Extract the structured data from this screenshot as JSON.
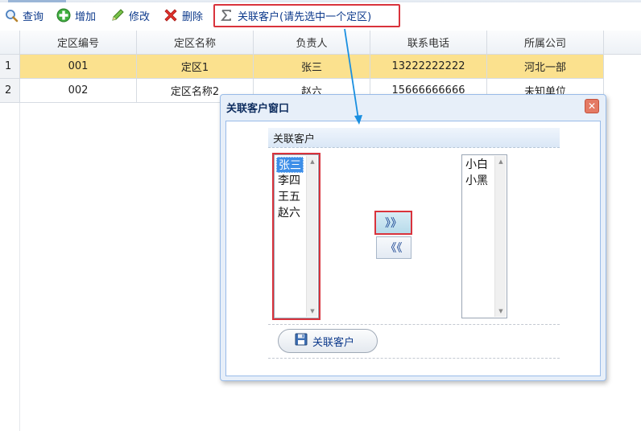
{
  "toolbar": {
    "query_label": "查询",
    "add_label": "增加",
    "edit_label": "修改",
    "delete_label": "删除",
    "assoc_label": "关联客户(请先选中一个定区)"
  },
  "grid": {
    "headers": [
      "定区编号",
      "定区名称",
      "负责人",
      "联系电话",
      "所属公司"
    ],
    "rows": [
      {
        "num": "1",
        "cells": [
          "001",
          "定区1",
          "张三",
          "13222222222",
          "河北一部"
        ]
      },
      {
        "num": "2",
        "cells": [
          "002",
          "定区名称2",
          "赵六",
          "15666666666",
          "未知单位"
        ]
      }
    ]
  },
  "dialog": {
    "title": "关联客户窗口",
    "close_glyph": "✕",
    "panel_title": "关联客户",
    "left_list": [
      "张三",
      "李四",
      "王五",
      "赵六"
    ],
    "right_list": [
      "小白",
      "小黑"
    ],
    "move_right": "》》",
    "move_left": "《《",
    "submit_label": "关联客户"
  },
  "colors": {
    "highlight_red": "#d9333c",
    "selected_row": "#fbe18e",
    "arrow_blue": "#1a8fe0"
  }
}
